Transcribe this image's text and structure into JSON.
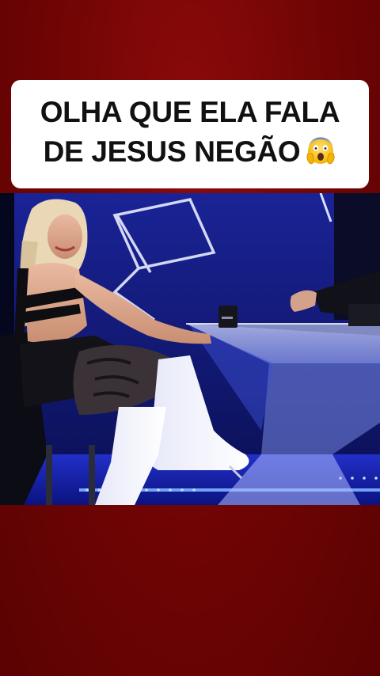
{
  "caption": {
    "line1": "OLHA QUE ELA FALA",
    "line2": "DE JESUS NEGÃO",
    "emoji": "screaming-face-icon"
  },
  "colors": {
    "background": "#7a0506",
    "caption_bg": "#ffffff",
    "caption_text": "#111111",
    "studio_blue": "#1c2aa8",
    "led_blue": "#3b7bff"
  },
  "video": {
    "scene": "tv-studio-interview-frame"
  }
}
